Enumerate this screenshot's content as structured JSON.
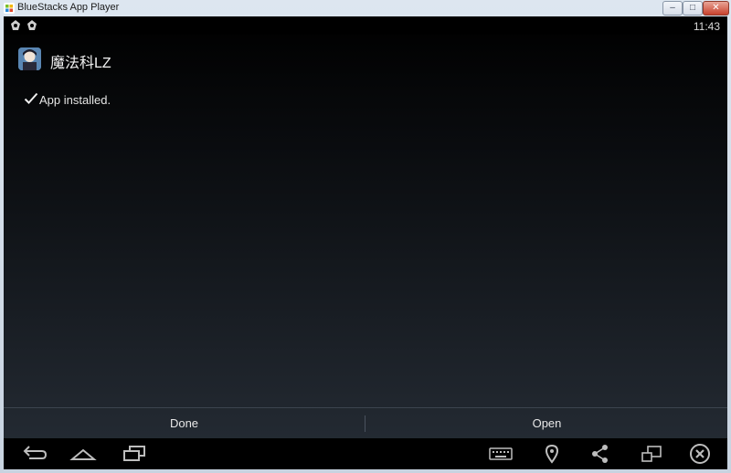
{
  "window": {
    "title": "BlueStacks App Player",
    "controls": {
      "minimize": "–",
      "maximize": "□",
      "close": "✕"
    }
  },
  "statusbar": {
    "icons": [
      "bluestacks-notification-icon",
      "bluestacks-notification-icon"
    ],
    "time": "11:43"
  },
  "app": {
    "name": "魔法科LZ",
    "icon": "app-icon",
    "status_icon": "check-icon",
    "status": "App installed."
  },
  "actions": {
    "done_label": "Done",
    "open_label": "Open"
  },
  "navbar": {
    "left": [
      "back-icon",
      "home-icon",
      "recent-apps-icon"
    ],
    "right": [
      "keyboard-icon",
      "location-icon",
      "share-icon",
      "window-resize-icon",
      "close-icon"
    ]
  },
  "colors": {
    "screen_top": "#000000",
    "screen_bottom": "#262d36",
    "text": "#e8e8e8"
  }
}
